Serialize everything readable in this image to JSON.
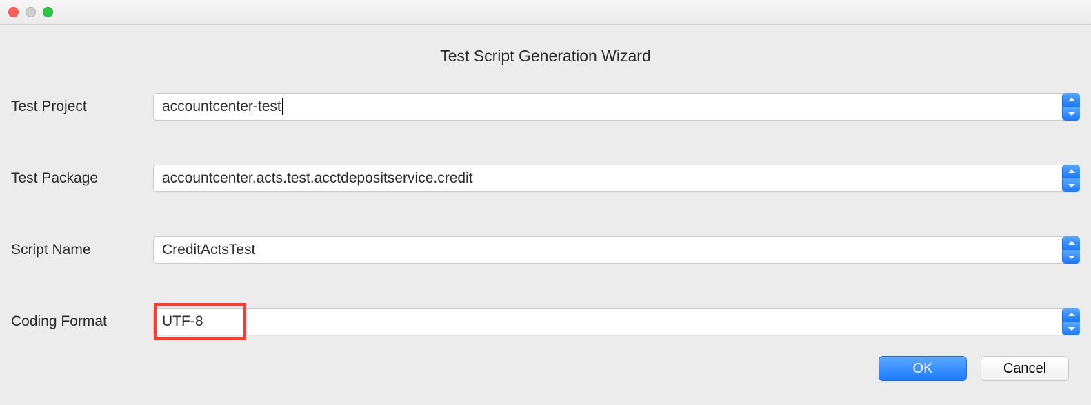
{
  "window": {
    "title": "Test Script Generation Wizard"
  },
  "fields": {
    "testProject": {
      "label": "Test Project",
      "value": "accountcenter-test"
    },
    "testPackage": {
      "label": "Test Package",
      "value": "accountcenter.acts.test.acctdepositservice.credit"
    },
    "scriptName": {
      "label": "Script Name",
      "value": "CreditActsTest"
    },
    "codingFormat": {
      "label": "Coding Format",
      "value": "UTF-8"
    }
  },
  "buttons": {
    "ok": "OK",
    "cancel": "Cancel"
  }
}
